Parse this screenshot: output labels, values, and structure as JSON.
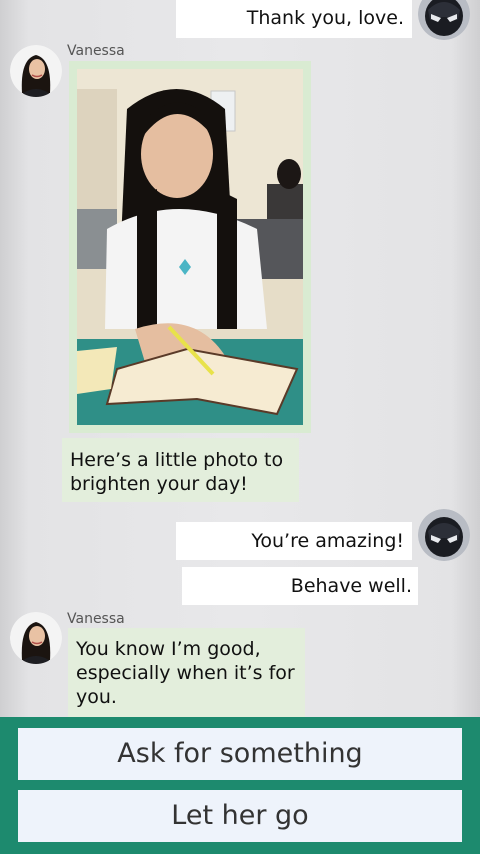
{
  "messages": [
    {
      "text": "Thank you, love."
    },
    {
      "sender": "Vanessa"
    },
    {
      "text": "Here’s a little photo to brighten your day!"
    },
    {
      "text": "You’re amazing!"
    },
    {
      "text": "Behave well."
    },
    {
      "sender": "Vanessa",
      "text": "You know I’m good, especially when it’s for you."
    }
  ],
  "choices": [
    "Ask for something",
    "Let her go"
  ],
  "colors": {
    "outgoing_bubble": "#ffffff",
    "incoming_bubble": "#e3eedc",
    "choice_bar": "#1d8a6e",
    "choice_button": "#eef3fb"
  },
  "icons": {
    "user_avatar": "black-mask-avatar-icon",
    "contact_avatar": "vanessa-avatar"
  }
}
